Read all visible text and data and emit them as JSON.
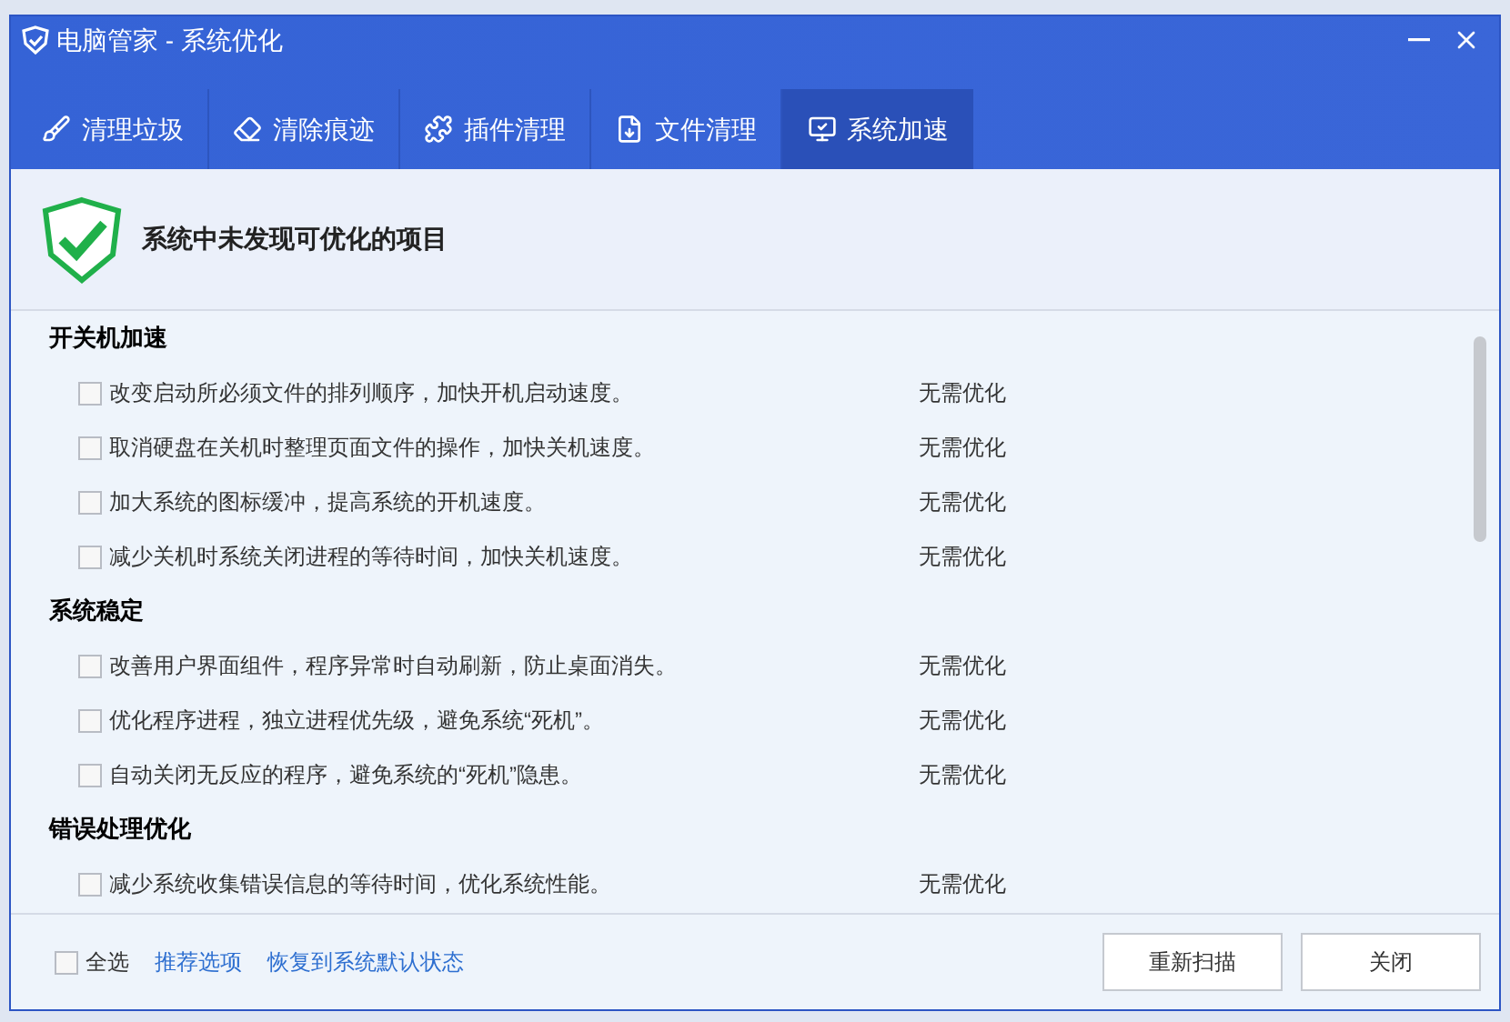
{
  "window": {
    "title": "电脑管家 - 系统优化"
  },
  "tabs": [
    {
      "label": "清理垃圾",
      "selected": false,
      "kind": "broom"
    },
    {
      "label": "清除痕迹",
      "selected": false,
      "kind": "eraser"
    },
    {
      "label": "插件清理",
      "selected": false,
      "kind": "puzzle"
    },
    {
      "label": "文件清理",
      "selected": false,
      "kind": "file"
    },
    {
      "label": "系统加速",
      "selected": true,
      "kind": "monitor"
    }
  ],
  "status_message": "系统中未发现可优化的项目",
  "sections": [
    {
      "title": "开关机加速",
      "items": [
        {
          "label": "改变启动所必须文件的排列顺序，加快开机启动速度。",
          "checked": false,
          "status": "无需优化"
        },
        {
          "label": "取消硬盘在关机时整理页面文件的操作，加快关机速度。",
          "checked": false,
          "status": "无需优化"
        },
        {
          "label": "加大系统的图标缓冲，提高系统的开机速度。",
          "checked": false,
          "status": "无需优化"
        },
        {
          "label": "减少关机时系统关闭进程的等待时间，加快关机速度。",
          "checked": false,
          "status": "无需优化"
        }
      ]
    },
    {
      "title": "系统稳定",
      "items": [
        {
          "label": "改善用户界面组件，程序异常时自动刷新，防止桌面消失。",
          "checked": false,
          "status": "无需优化"
        },
        {
          "label": "优化程序进程，独立进程优先级，避免系统“死机”。",
          "checked": false,
          "status": "无需优化"
        },
        {
          "label": "自动关闭无反应的程序，避免系统的“死机”隐患。",
          "checked": false,
          "status": "无需优化"
        }
      ]
    },
    {
      "title": "错误处理优化",
      "items": [
        {
          "label": "减少系统收集错误信息的等待时间，优化系统性能。",
          "checked": false,
          "status": "无需优化"
        }
      ]
    }
  ],
  "footer": {
    "select_all": {
      "label": "全选",
      "checked": false
    },
    "links": [
      "推荐选项",
      "恢复到系统默认状态"
    ],
    "buttons": [
      "重新扫描",
      "关闭"
    ]
  }
}
